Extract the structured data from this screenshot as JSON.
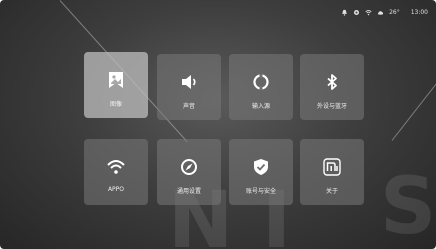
{
  "status_bar": {
    "icons": [
      "notification-icon",
      "settings-icon",
      "wifi-icon",
      "weather-icon"
    ],
    "temperature": "26°",
    "time": "13:00"
  },
  "tiles": [
    {
      "label": "图像",
      "icon": "image-icon",
      "selected": true
    },
    {
      "label": "声音",
      "icon": "speaker-icon",
      "selected": false
    },
    {
      "label": "输入源",
      "icon": "input-source-icon",
      "selected": false
    },
    {
      "label": "外设与蓝牙",
      "icon": "bluetooth-icon",
      "selected": false
    },
    {
      "label": "APPO",
      "icon": "wifi-icon",
      "selected": false
    },
    {
      "label": "通用设置",
      "icon": "compass-icon",
      "selected": false
    },
    {
      "label": "账号与安全",
      "icon": "shield-check-icon",
      "selected": false
    },
    {
      "label": "关于",
      "icon": "mi-logo-icon",
      "selected": false
    }
  ],
  "background_letters": [
    "N",
    "I",
    "S"
  ]
}
